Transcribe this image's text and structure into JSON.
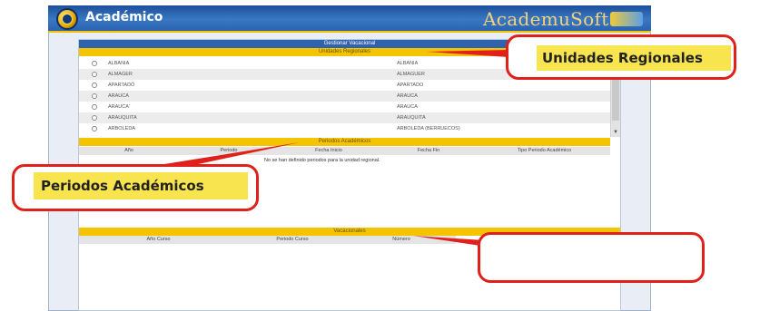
{
  "header": {
    "app_title": "Académico",
    "brand": "AcademuSoft"
  },
  "main": {
    "section_title": "Gestionar Vacacional",
    "regional": {
      "title": "Unidades Regionales",
      "rows": [
        {
          "c1": "ALBANIA",
          "c2": "ALBANIA"
        },
        {
          "c1": "ALMAGER",
          "c2": "ALMAGUER"
        },
        {
          "c1": "APARTADÓ",
          "c2": "APARTADO"
        },
        {
          "c1": "ARAUCA",
          "c2": "ARAUCA"
        },
        {
          "c1": "ARAUCA'",
          "c2": "ARAUCA"
        },
        {
          "c1": "ARAUQUITA",
          "c2": "ARAUQUITA"
        },
        {
          "c1": "ARBOLEDA",
          "c2": "ARBOLEDA (BERRUECOS)"
        }
      ]
    },
    "periodos": {
      "title": "Periodos Académicos",
      "columns": [
        "Año",
        "Periodo",
        "Fecha Inicio",
        "Fecha Fin",
        "Tipo Periodo Académico"
      ],
      "empty_message": "No se han definido periodos para la unidad regional."
    },
    "vacacionales": {
      "title": "Vacacionales",
      "columns": [
        "Año Curso",
        "Periodo Curso",
        "Número"
      ]
    }
  },
  "callouts": {
    "unidades": "Unidades Regionales",
    "periodos": "Periodos Académicos",
    "vacacionales": ""
  }
}
